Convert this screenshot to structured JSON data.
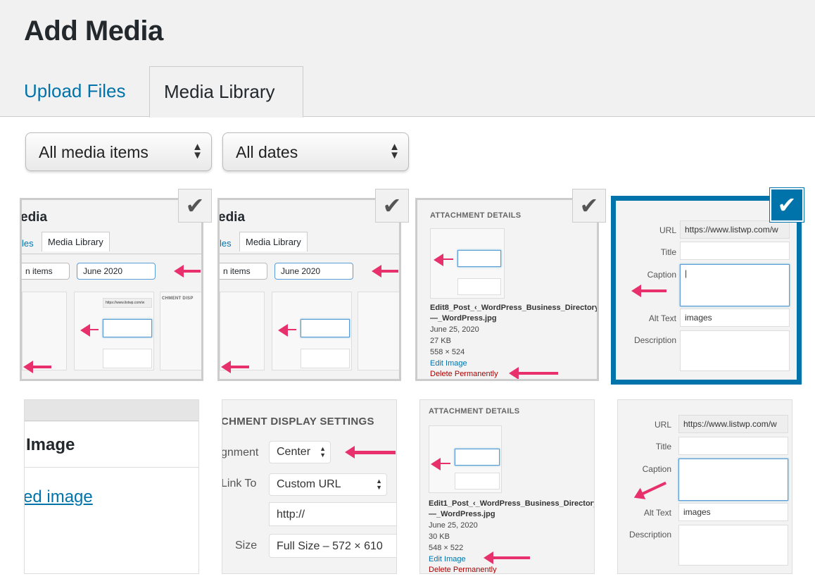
{
  "header": {
    "title": "Add Media"
  },
  "tabs": [
    {
      "label": "Upload Files"
    },
    {
      "label": "Media Library"
    }
  ],
  "filters": {
    "type": "All media items",
    "date": "All dates"
  },
  "thumb1": {
    "title": "edia",
    "tab_left": "les",
    "tab": "Media Library",
    "sel1": "n items",
    "sel2": "June 2020",
    "hdr": "CHMENT DISP",
    "url_val": "https://www.listwp.com/w",
    "labels": [
      "URL",
      "Title",
      "Caption",
      "Alt Text",
      "Description"
    ],
    "alt_val": "images",
    "row1": "gnment",
    "row2": "Link To",
    "row3": "Size",
    "v1": "Cen",
    "v2": "Cus",
    "v3": "http",
    "v4": "Ful"
  },
  "thumb3": {
    "hdr": "ATTACHMENT DETAILS",
    "filename": "Edit8_Post_‹_WordPress_Business_Directory_—_WordPress.jpg",
    "date": "June 25, 2020",
    "size": "27 KB",
    "dims": "558 × 524",
    "edit": "Edit Image",
    "delete": "Delete Permanently"
  },
  "thumb4": {
    "labels": [
      "URL",
      "Title",
      "Caption",
      "Alt Text",
      "Description"
    ],
    "url_val": "https://www.listwp.com/w",
    "alt_val": "images"
  },
  "thumb5": {
    "title": "Image",
    "link": "ed image"
  },
  "thumb6": {
    "hdr": "CHMENT DISPLAY SETTINGS",
    "labels": [
      "gnment",
      "Link To",
      "Size"
    ],
    "align": "Center",
    "link": "Custom URL",
    "url": "http://",
    "size": "Full Size – 572 × 610"
  },
  "thumb7": {
    "hdr": "ATTACHMENT DETAILS",
    "filename": "Edit1_Post_‹_WordPress_Business_Directory_—_WordPress.jpg",
    "date": "June 25, 2020",
    "size": "30 KB",
    "dims": "548 × 522",
    "edit": "Edit Image",
    "delete": "Delete Permanently"
  },
  "thumb8": {
    "labels": [
      "URL",
      "Title",
      "Caption",
      "Alt Text",
      "Description"
    ],
    "url_val": "https://www.listwp.com/w",
    "alt_val": "images"
  },
  "colors": {
    "accent": "#0073aa",
    "arrow": "#e8316c",
    "delete": "#aa0000"
  },
  "icons": {
    "check": "checkmark-icon",
    "select": "updown-arrows-icon"
  }
}
